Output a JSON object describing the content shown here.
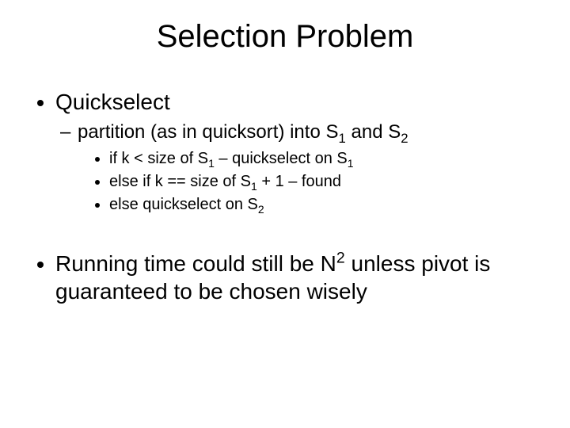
{
  "title": "Selection Problem",
  "b1": "Quickselect",
  "b1a_pre": "partition (as in quicksort) into S",
  "b1a_mid": " and S",
  "b1a_i_preA": "if k < size of S",
  "b1a_i_preB": " – quickselect on S",
  "b1a_ii_preA": "else if k == size of S",
  "b1a_ii_preB": " + 1 – found",
  "b1a_iii_preA": "else quickselect on S",
  "b2_preA": "Running time could still be N",
  "b2_preB": " unless pivot is guaranteed to be chosen wisely",
  "sub1": "1",
  "sub2": "2",
  "sup2": "2"
}
